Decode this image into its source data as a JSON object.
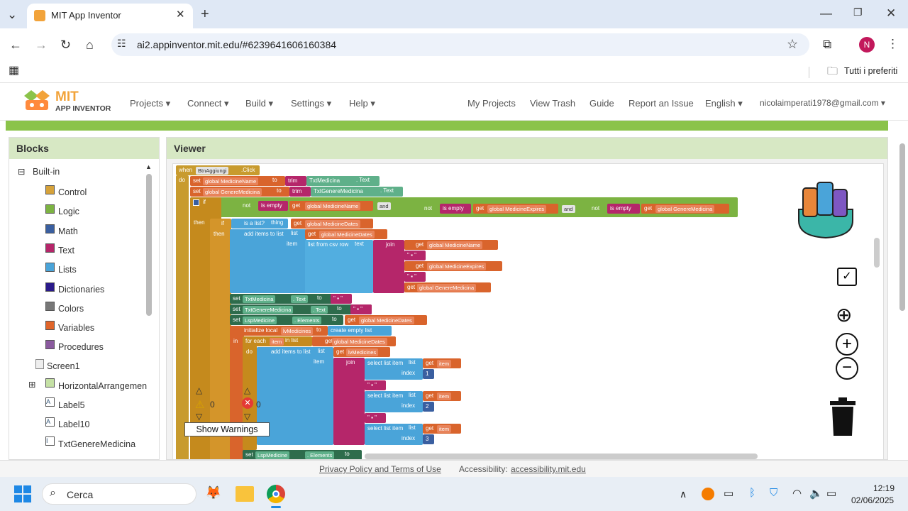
{
  "browser": {
    "tab_title": "MIT App Inventor",
    "url": "ai2.appinventor.mit.edu/#6239641606160384",
    "bookmarks_label": "Tutti i preferiti",
    "profile_initial": "N"
  },
  "app": {
    "logo_mit": "MIT",
    "logo_sub": "APP INVENTOR",
    "menu": [
      "Projects",
      "Connect",
      "Build",
      "Settings",
      "Help"
    ],
    "right_menu": [
      "My Projects",
      "View Trash",
      "Guide",
      "Report an Issue",
      "English",
      "nicolaimperati1978@gmail.com"
    ]
  },
  "blocks_panel": {
    "title": "Blocks",
    "builtin": "Built-in",
    "builtin_items": [
      {
        "label": "Control",
        "color": "#d6a23a"
      },
      {
        "label": "Logic",
        "color": "#7cb342"
      },
      {
        "label": "Math",
        "color": "#3a5fa0"
      },
      {
        "label": "Text",
        "color": "#b5266a"
      },
      {
        "label": "Lists",
        "color": "#4aa4d9"
      },
      {
        "label": "Dictionaries",
        "color": "#2a1a8a"
      },
      {
        "label": "Colors",
        "color": "#777777"
      },
      {
        "label": "Variables",
        "color": "#e0652a"
      },
      {
        "label": "Procedures",
        "color": "#8a5a9e"
      }
    ],
    "screen": "Screen1",
    "components": [
      "HorizontalArrangemen",
      "Label5",
      "Label10",
      "TxtGenereMedicina"
    ]
  },
  "viewer": {
    "title": "Viewer",
    "warn_count": "0",
    "error_count": "0",
    "show_warnings": "Show Warnings"
  },
  "code": {
    "when": "when",
    "event": "BtnAggiungi",
    "click": ".Click",
    "do": "do",
    "l1": [
      "set",
      "global MedicineName",
      "to",
      "trim",
      "TxtMedicina",
      ". Text"
    ],
    "l2": [
      "set",
      "global GenereMedicina",
      "to",
      "trim",
      "TxtGenereMedicina",
      ". Text"
    ],
    "if_row": [
      "if",
      "not",
      "is empty",
      "get",
      "global MedicineName",
      "and",
      "not",
      "is empty",
      "get",
      "global MedicineExpires",
      "and",
      "not",
      "is empty",
      "get",
      "global GenereMedicina"
    ],
    "then": "then",
    "inner_if": [
      "if",
      "is a list?",
      "thing",
      "get",
      "global MedicineDates"
    ],
    "add1": [
      "add items to list",
      "list",
      "get",
      "global MedicineDates"
    ],
    "item": "item",
    "csv": "list from csv row",
    "text": "text",
    "join": "join",
    "join_items": [
      "get",
      "global MedicineName",
      "get",
      "global MedicineExpires",
      "get",
      "global GenereMedicina"
    ],
    "set_txt": [
      "set",
      "TxtMedicina",
      ". Text",
      "to"
    ],
    "set_gen": [
      "set",
      "TxtGenereMedicina",
      ". Text",
      "to"
    ],
    "set_lsp": [
      "set",
      "LspMedicine",
      ". Elements",
      "to",
      "get",
      "global MedicineDates"
    ],
    "init": [
      "initialize local",
      "lvMedicines",
      "to",
      "create empty list"
    ],
    "in": "in",
    "foreach": [
      "for each",
      "item",
      "in list",
      "get",
      "global MedicineDates"
    ],
    "add2": [
      "add items to list",
      "list",
      "get",
      "lvMedicines"
    ],
    "sel": [
      "select list item",
      "list",
      "get",
      "item",
      "index"
    ],
    "idx": [
      "1",
      "2",
      "3"
    ],
    "set_lsp2": [
      "set",
      "LspMedicine",
      ". Elements",
      "to"
    ]
  },
  "footer": {
    "privacy": "Privacy Policy and Terms of Use",
    "access_label": "Accessibility:",
    "access_link": "accessibility.mit.edu"
  },
  "taskbar": {
    "search": "Cerca",
    "time": "12:19",
    "date": "02/06/2025"
  }
}
